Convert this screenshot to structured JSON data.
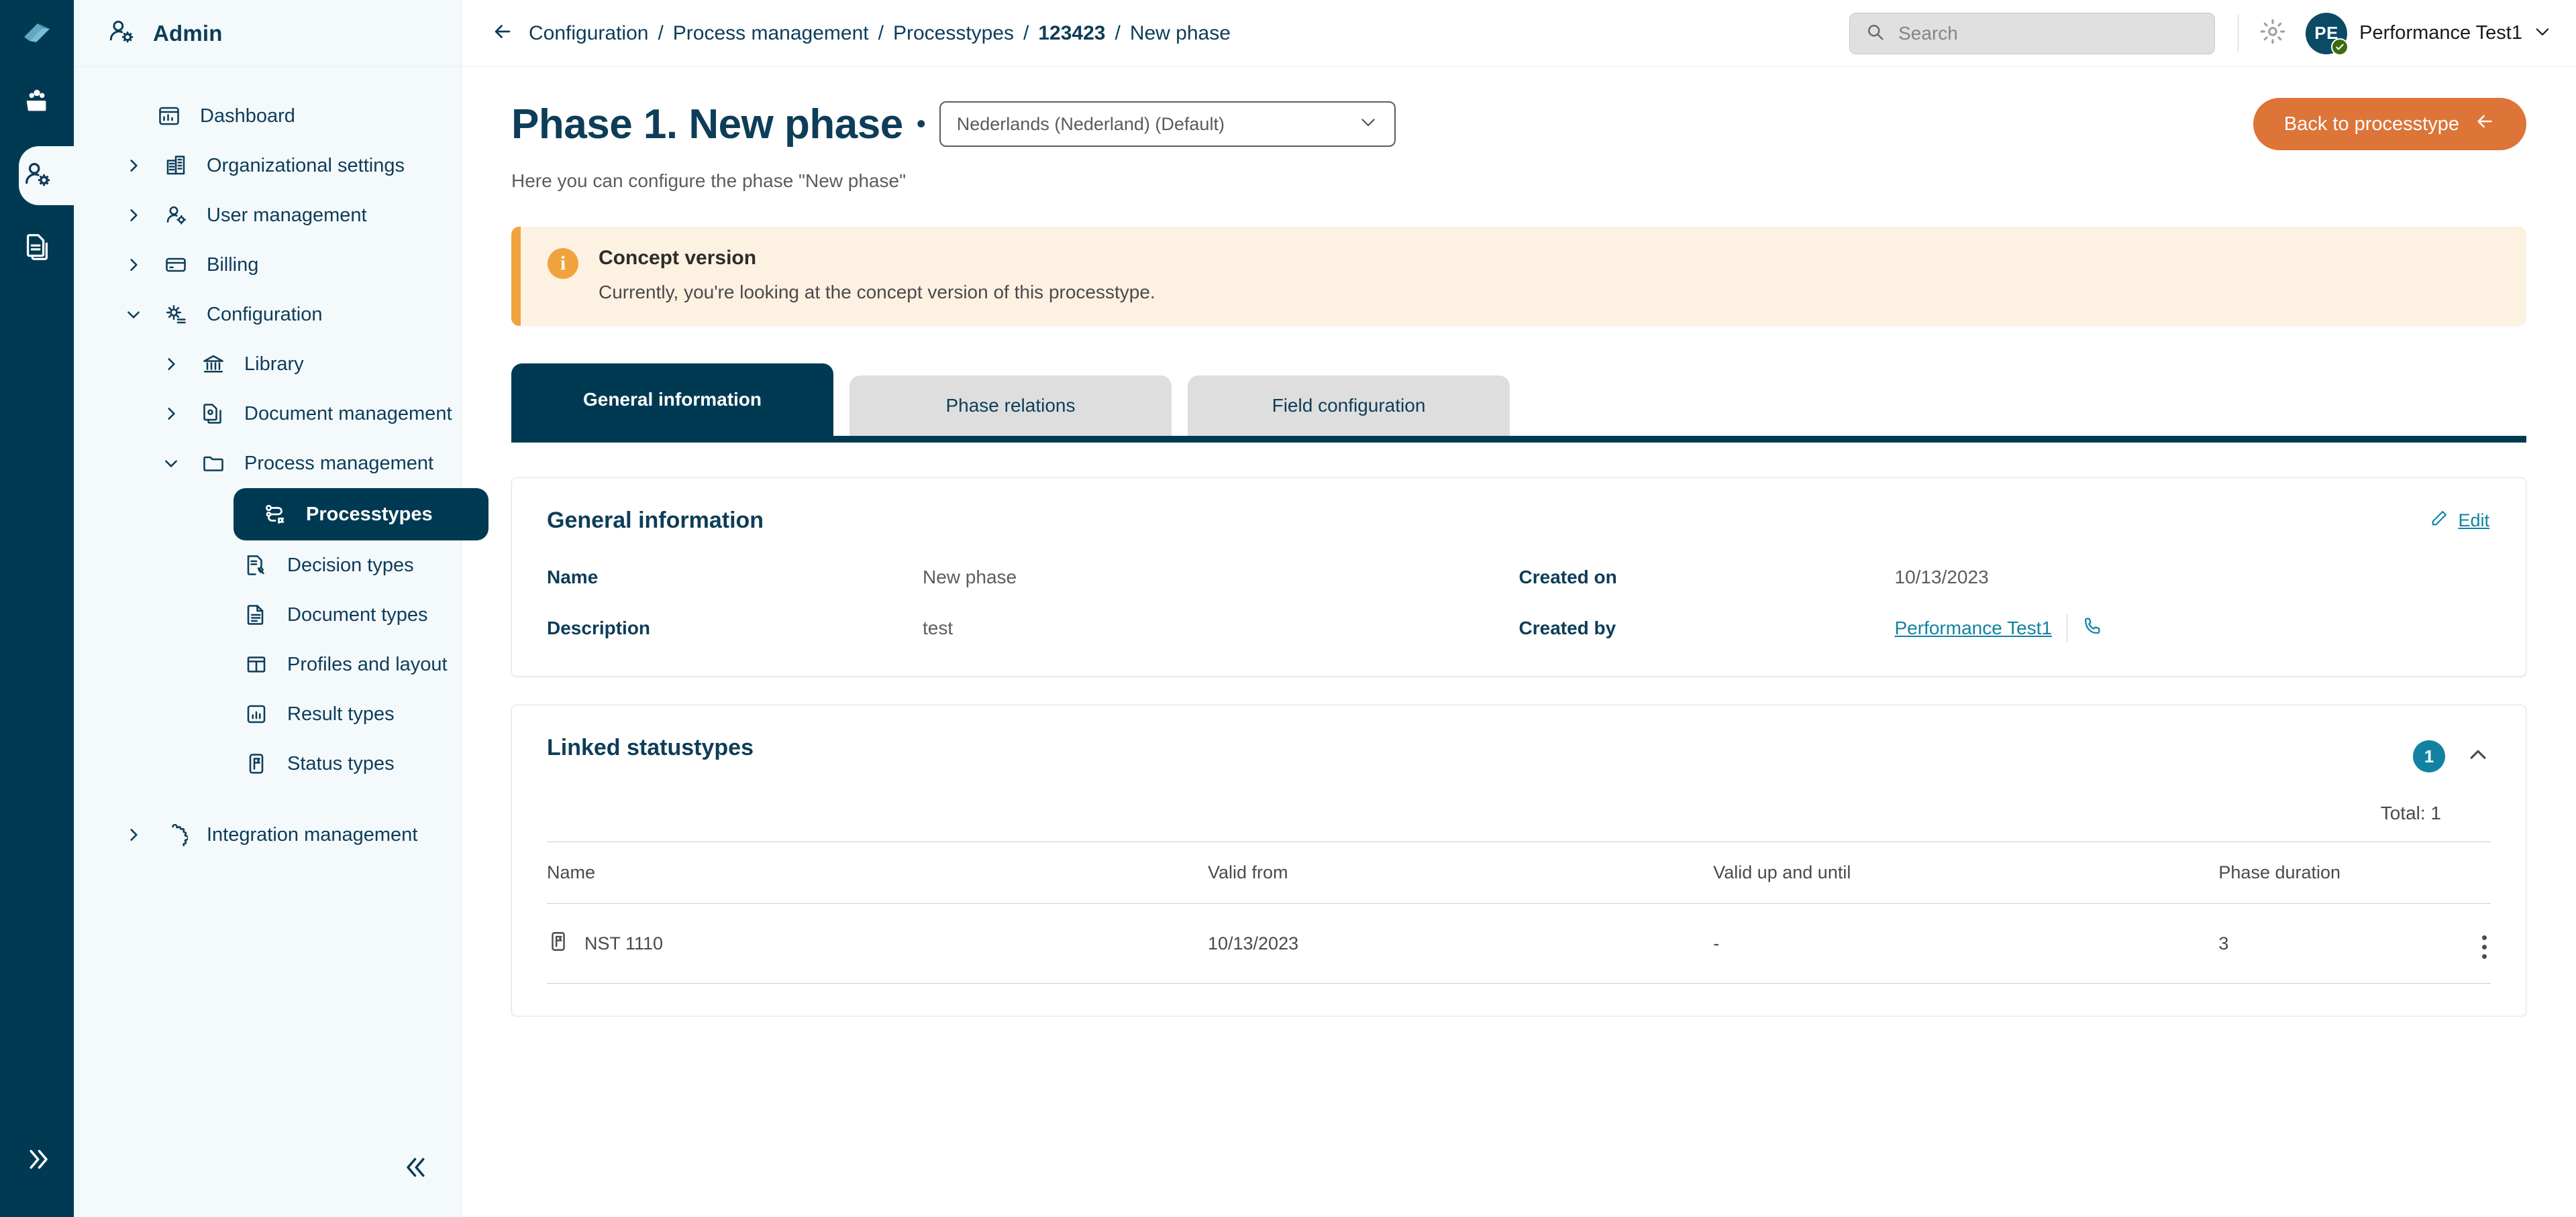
{
  "rail": {
    "logo_icon": "app-logo-icon",
    "items": [
      {
        "icon": "group-folder-icon",
        "name": "workspaces",
        "active": false
      },
      {
        "icon": "user-cog-icon",
        "name": "admin",
        "active": true
      },
      {
        "icon": "documents-icon",
        "name": "documents",
        "active": false
      }
    ],
    "collapse_icon": "chevron-double-right-icon"
  },
  "sidebar": {
    "header": {
      "label": "Admin",
      "icon": "user-cog-icon"
    },
    "collapse_icon": "chevron-double-left-icon",
    "items": [
      {
        "label": "Dashboard",
        "icon": "dashboard-icon",
        "level": 0,
        "expandable": false,
        "expanded": false,
        "active": false
      },
      {
        "label": "Organizational settings",
        "icon": "building-icon",
        "level": 0,
        "expandable": true,
        "expanded": false,
        "active": false
      },
      {
        "label": "User management",
        "icon": "user-cog-icon",
        "level": 0,
        "expandable": true,
        "expanded": false,
        "active": false
      },
      {
        "label": "Billing",
        "icon": "credit-card-icon",
        "level": 0,
        "expandable": true,
        "expanded": false,
        "active": false
      },
      {
        "label": "Configuration",
        "icon": "gear-list-icon",
        "level": 0,
        "expandable": true,
        "expanded": true,
        "active": false
      },
      {
        "label": "Library",
        "icon": "bank-icon",
        "level": 1,
        "expandable": true,
        "expanded": false,
        "active": false
      },
      {
        "label": "Document management",
        "icon": "document-gear-icon",
        "level": 1,
        "expandable": true,
        "expanded": false,
        "active": false
      },
      {
        "label": "Process management",
        "icon": "folder-icon",
        "level": 1,
        "expandable": true,
        "expanded": true,
        "active": false
      },
      {
        "label": "Processtypes",
        "icon": "processtype-icon",
        "level": 2,
        "expandable": false,
        "expanded": false,
        "active": true
      },
      {
        "label": "Decision types",
        "icon": "decision-icon",
        "level": 2,
        "expandable": false,
        "expanded": false,
        "active": false
      },
      {
        "label": "Document types",
        "icon": "document-icon",
        "level": 2,
        "expandable": false,
        "expanded": false,
        "active": false
      },
      {
        "label": "Profiles and layout",
        "icon": "layout-icon",
        "level": 2,
        "expandable": false,
        "expanded": false,
        "active": false
      },
      {
        "label": "Result types",
        "icon": "chart-icon",
        "level": 2,
        "expandable": false,
        "expanded": false,
        "active": false
      },
      {
        "label": "Status types",
        "icon": "status-flag-icon",
        "level": 2,
        "expandable": false,
        "expanded": false,
        "active": false
      },
      {
        "label": "Integration management",
        "icon": "puzzle-icon",
        "level": 0,
        "expandable": true,
        "expanded": false,
        "active": false
      }
    ]
  },
  "topbar": {
    "back_icon": "arrow-left-icon",
    "breadcrumb": [
      {
        "label": "Configuration",
        "strong": false
      },
      {
        "label": "Process management",
        "strong": false
      },
      {
        "label": "Processtypes",
        "strong": false
      },
      {
        "label": "123423",
        "strong": true
      },
      {
        "label": "New phase",
        "strong": false
      }
    ],
    "separator": "/",
    "search": {
      "placeholder": "Search",
      "value": "",
      "icon": "search-icon"
    },
    "gear_icon": "gear-icon",
    "user": {
      "initials": "PE",
      "name": "Performance Test1",
      "status_icon": "check-badge-icon",
      "chevron_icon": "chevron-down-icon"
    }
  },
  "page": {
    "title": "Phase 1. New phase",
    "title_dot": "•",
    "language": {
      "value": "Nederlands (Nederland) (Default)",
      "chevron_icon": "chevron-down-icon"
    },
    "subtitle": "Here you can configure the phase \"New phase\"",
    "back_button": {
      "label": "Back to processtype",
      "icon": "arrow-left-icon"
    }
  },
  "alert": {
    "icon": "info-icon",
    "title": "Concept version",
    "text": "Currently, you're looking at the concept version of this processtype."
  },
  "tabs": [
    {
      "label": "General information",
      "active": true
    },
    {
      "label": "Phase relations",
      "active": false
    },
    {
      "label": "Field configuration",
      "active": false
    }
  ],
  "general_information": {
    "title": "General information",
    "edit": {
      "label": "Edit",
      "icon": "pencil-icon"
    },
    "left_rows": [
      {
        "label": "Name",
        "value": "New phase"
      },
      {
        "label": "Description",
        "value": "test"
      }
    ],
    "right_rows": [
      {
        "label": "Created on",
        "value": "10/13/2023"
      },
      {
        "label": "Created by",
        "value": "Performance Test1",
        "link": true,
        "phone_icon": "phone-icon"
      }
    ]
  },
  "linked_statustypes": {
    "title": "Linked statustypes",
    "count": "1",
    "collapse_icon": "chevron-up-icon",
    "total_label": "Total: 1",
    "columns": [
      "Name",
      "Valid from",
      "Valid up and until",
      "Phase duration"
    ],
    "rows": [
      {
        "name": "NST 1110",
        "name_icon": "status-flag-icon",
        "valid_from": "10/13/2023",
        "valid_until": "-",
        "phase_duration": "3",
        "menu_icon": "kebab-menu-icon"
      }
    ]
  },
  "colors": {
    "brand_dark": "#003a52",
    "sidebar_bg": "#f4f9fc",
    "accent_teal": "#1282a2",
    "accent_orange": "#dd7438",
    "alert_bg": "#fdf1e2",
    "alert_border": "#f0a33c"
  }
}
